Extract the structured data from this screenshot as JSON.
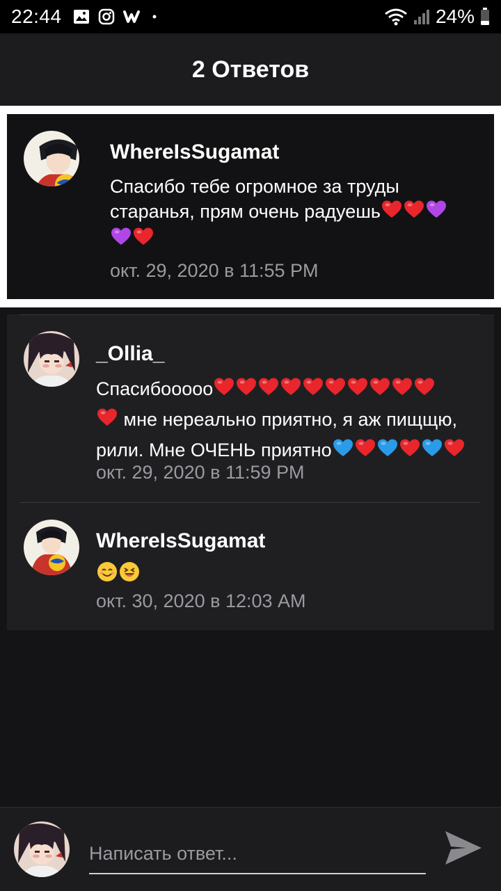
{
  "status_bar": {
    "time": "22:44",
    "battery": "24%",
    "icons": [
      "gallery-icon",
      "instagram-icon",
      "wattpad-icon",
      "dot-icon",
      "wifi-icon",
      "signal-icon",
      "battery-icon"
    ]
  },
  "header": {
    "title": "2 Ответов"
  },
  "parent_comment": {
    "username": "WhereIsSugamat",
    "text_line1": "Спасибо тебе огромное за труды",
    "text_line2": "старанья, прям очень радуешь",
    "emojis_line2": [
      "red-heart",
      "red-heart",
      "purple-heart"
    ],
    "emojis_line3": [
      "purple-heart",
      "red-heart"
    ],
    "timestamp": "окт. 29, 2020 в 11:55 PM"
  },
  "replies": [
    {
      "username": "_Ollia_",
      "text_line1": "Спасибооооо",
      "emojis_line1": [
        "red-heart",
        "red-heart",
        "red-heart",
        "red-heart",
        "red-heart",
        "red-heart",
        "red-heart",
        "red-heart",
        "red-heart",
        "red-heart"
      ],
      "emojis_line2_prefix": [
        "red-heart"
      ],
      "text_line2": "мне нереально приятно, я аж пищщю,",
      "text_line3": "рили. Мне ОЧЕНЬ приятно",
      "emojis_line3": [
        "blue-heart",
        "red-heart",
        "blue-heart",
        "red-heart",
        "blue-heart",
        "red-heart"
      ],
      "timestamp": "окт. 29, 2020 в 11:59 PM"
    },
    {
      "username": "WhereIsSugamat",
      "emojis": [
        "smiling-face",
        "grinning-squinting-face"
      ],
      "timestamp": "окт. 30, 2020 в 12:03 AM"
    }
  ],
  "input": {
    "placeholder": "Написать ответ..."
  },
  "colors": {
    "background": "#141416",
    "header": "#1c1c1e",
    "reply_card": "#1f1f22",
    "timestamp": "#9a9aa0",
    "red_heart": "#e8262c",
    "purple_heart": "#b146e6",
    "blue_heart": "#2a9be8"
  }
}
